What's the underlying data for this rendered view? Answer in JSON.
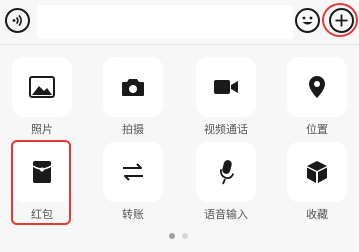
{
  "input_bar": {
    "voice_icon": "voice-wave-icon",
    "text_placeholder": "",
    "emoji_icon": "emoji-icon",
    "plus_icon": "plus-icon"
  },
  "panel": {
    "items": [
      {
        "label": "照片",
        "icon": "photo-icon"
      },
      {
        "label": "拍摄",
        "icon": "camera-icon"
      },
      {
        "label": "视频通话",
        "icon": "video-call-icon"
      },
      {
        "label": "位置",
        "icon": "location-pin-icon"
      },
      {
        "label": "红包",
        "icon": "red-packet-icon"
      },
      {
        "label": "转账",
        "icon": "transfer-arrows-icon"
      },
      {
        "label": "语音输入",
        "icon": "microphone-icon"
      },
      {
        "label": "收藏",
        "icon": "favorites-cube-icon"
      }
    ],
    "page_count": 2,
    "current_page": 1
  },
  "colors": {
    "highlight": "#e53935",
    "icon": "#1a1a1a",
    "background": "#f7f7f7",
    "tile": "#ffffff"
  }
}
